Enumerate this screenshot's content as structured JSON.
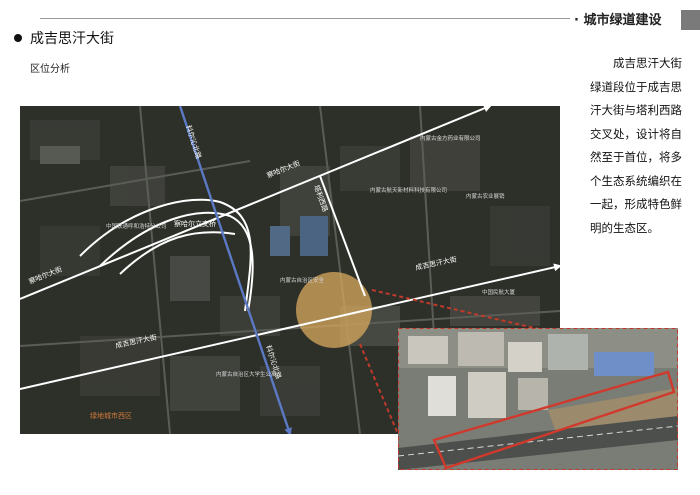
{
  "header": {
    "title": "· 城市绿道建设"
  },
  "section": {
    "title": "成吉思汗大街",
    "subtitle": "区位分析"
  },
  "description": "成吉思汗大街绿道段位于成吉思汗大街与塔利西路交叉处，设计将自然至于首位，将多个生态系统编织在一起，形成特色鲜明的生态区。",
  "map": {
    "roads": {
      "keqin_n": "科尔沁北路",
      "keqin_s": "科尔沁北路",
      "chahaer_e": "察哈尔大街",
      "chahaer_w": "察哈尔大街",
      "chahaer_bridge": "察哈尔立交桥",
      "genghis_w": "成吉思汗大街",
      "genghis_e": "成吉思汗大街",
      "tali": "塔利西路"
    },
    "poi": {
      "p1": "中国联通呼和浩特分公司",
      "p2": "内蒙古金方药业有限公司",
      "p3": "内蒙古航天新材料科技有限公司",
      "p4": "内蒙古农业展销",
      "p5": "内蒙古自治区安全",
      "p6": "内蒙古自治区大学生公寓",
      "p7": "中国民航大厦",
      "p8": "绿地城市西区"
    }
  }
}
